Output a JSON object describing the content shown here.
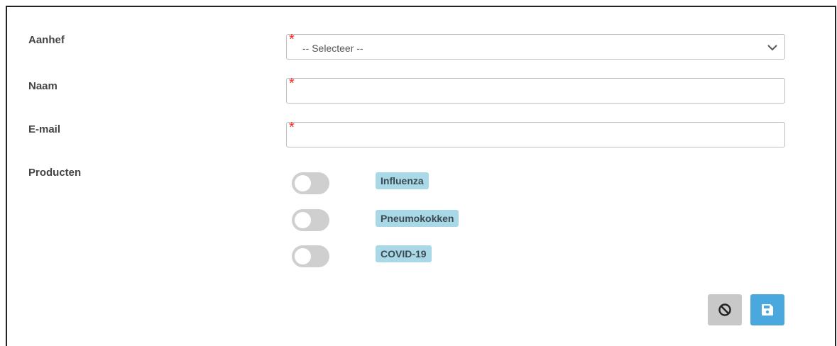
{
  "form": {
    "fields": [
      {
        "label": "Aanhef",
        "type": "select",
        "value": "-- Selecteer --",
        "required": true
      },
      {
        "label": "Naam",
        "type": "text",
        "value": "",
        "required": true
      },
      {
        "label": "E-mail",
        "type": "text",
        "value": "",
        "required": true
      }
    ],
    "required_marker": "*",
    "products_label": "Producten",
    "products": [
      {
        "name": "Influenza",
        "enabled": false
      },
      {
        "name": "Pneumokokken",
        "enabled": false
      },
      {
        "name": "COVID-19",
        "enabled": false
      }
    ]
  },
  "actions": {
    "cancel_icon": "ban-icon",
    "save_icon": "floppy-disk-icon"
  },
  "colors": {
    "required": "#ff2020",
    "badge_bg": "#a9d8e6",
    "save_button": "#4aa8de",
    "cancel_button": "#c8c8c8",
    "toggle_off": "#cfcfcf"
  }
}
